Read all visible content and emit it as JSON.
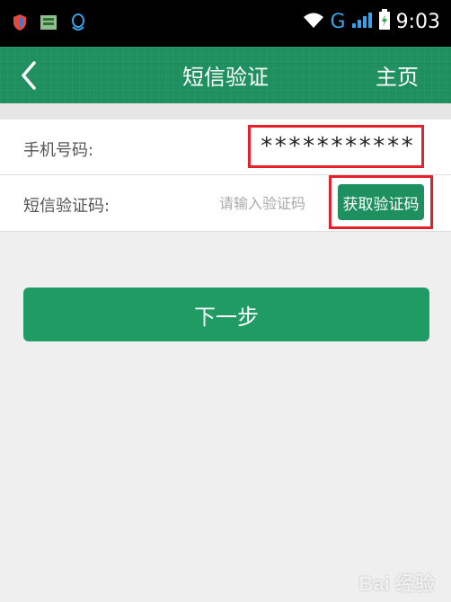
{
  "status_bar": {
    "network": "G",
    "time": "9:03",
    "icons": [
      "shield-icon",
      "app-icon",
      "qq-icon",
      "wifi-icon",
      "signal-icon",
      "battery-icon"
    ]
  },
  "header": {
    "back_icon": "chevron-left-icon",
    "title": "短信验证",
    "home_label": "主页"
  },
  "form": {
    "phone_label": "手机号码:",
    "phone_value": "***********",
    "sms_label": "短信验证码:",
    "sms_placeholder": "请输入验证码",
    "get_code_label": "获取验证码"
  },
  "actions": {
    "next_label": "下一步"
  },
  "watermark": "Bai 经验",
  "colors": {
    "header": "#1e8f5e",
    "button": "#1f9b63",
    "highlight": "#e5202a"
  }
}
